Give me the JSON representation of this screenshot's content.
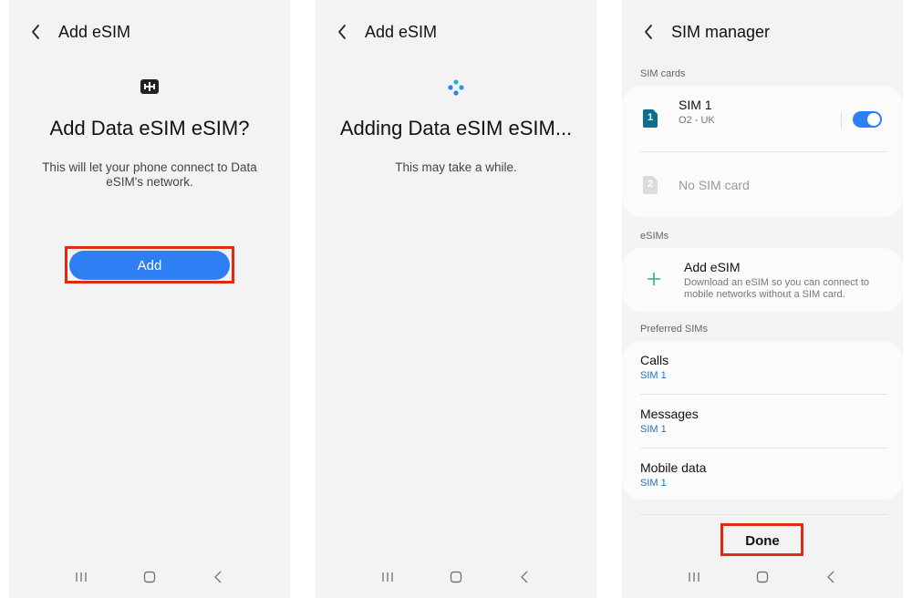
{
  "screen1": {
    "title": "Add eSIM",
    "heading": "Add Data eSIM eSIM?",
    "description": "This will let your phone connect to Data eSIM's network.",
    "add_label": "Add"
  },
  "screen2": {
    "title": "Add eSIM",
    "heading": "Adding Data eSIM eSIM...",
    "description": "This may take a while."
  },
  "screen3": {
    "title": "SIM manager",
    "sim_cards_label": "SIM cards",
    "sim1": {
      "badge": "1",
      "name": "SIM 1",
      "carrier": "O2 - UK",
      "enabled": true
    },
    "sim2": {
      "badge": "2",
      "name": "No SIM card"
    },
    "esims_label": "eSIMs",
    "add_esim": {
      "title": "Add eSIM",
      "description_line1": "Download an eSIM so you can connect to",
      "description_line2": "mobile networks without a SIM card."
    },
    "preferred_label": "Preferred SIMs",
    "preferred": [
      {
        "title": "Calls",
        "value": "SIM 1"
      },
      {
        "title": "Messages",
        "value": "SIM 1"
      },
      {
        "title": "Mobile data",
        "value": "SIM 1"
      }
    ],
    "done_label": "Done"
  },
  "icons": {
    "back": "chevron-left-icon",
    "sim": "sim-card-icon",
    "loading": "loading-dots-icon",
    "plus": "plus-icon",
    "recents": "recents-icon",
    "home": "home-icon",
    "nav_back": "nav-back-icon"
  },
  "colors": {
    "accent": "#2f7ff4",
    "highlight": "#e02a10",
    "link": "#1a73c8",
    "plus": "#2fb36a"
  }
}
